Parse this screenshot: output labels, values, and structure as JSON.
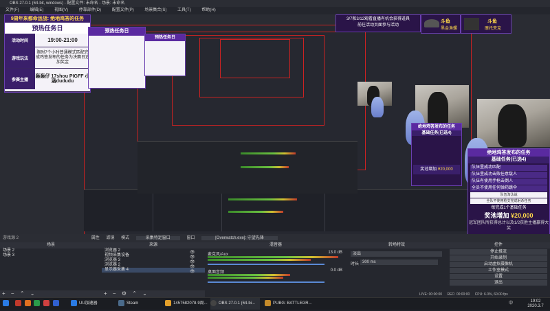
{
  "window": {
    "title": "OBS 27.0.1 (64-bit, windows) - 配置文件: 未命名 - 场景: 未命名"
  },
  "menu": [
    "文件(F)",
    "编辑(E)",
    "视图(V)",
    "停靠部件(D)",
    "配置文件(P)",
    "场景集合(S)",
    "工具(T)",
    "帮助(H)"
  ],
  "overlay": {
    "header": "9周年来都命运战: 绝地鸡答的任务",
    "title": "预热任务日",
    "rows": [
      {
        "key": "活动时间",
        "val": "19:00-21:00"
      },
      {
        "key": "游戏玩法",
        "val": "限时7个小时普通模式匹配完成鸡答发布的任务为决赛日追加奖金"
      },
      {
        "key": "参赛主播",
        "val": "轰轰仔 17shou    PIGFF 小涵dududu"
      }
    ],
    "promo": "3/7和3/12观看直播有机会获得道具\n前往活动页面参与活动",
    "brands": [
      {
        "title": "斗鱼",
        "sub": "黑金渔螺"
      },
      {
        "title": "斗鱼",
        "sub": "摩托夹克"
      }
    ],
    "task_panel": {
      "header": "绝地鸡答发布的任务",
      "sub": "基础任务(已选4)",
      "items": [
        "队伍里成功匹配",
        "队伍里成功击败任意敌人",
        "队伍有使用手枪击倒人",
        "全员不使用任何弹药跳伞"
      ],
      "extra": [
        "队伍淘汰战",
        "全队不使用枪支完成射杀任务"
      ],
      "note": "每完成1个基础任务",
      "bonus_label": "奖池增加",
      "bonus_value": "¥20,000",
      "foot": "冠军团队所获得总计以及1/2获胜主播赢得大奖"
    }
  },
  "toolbar": {
    "items": [
      "属性",
      "滤镜",
      "模式",
      "采集特定窗口",
      "窗口",
      "[Overwatch.exe]: 守望先锋"
    ]
  },
  "scenes": {
    "header": "场景",
    "items": [
      "场景 2",
      "场景 3"
    ]
  },
  "sources": {
    "header": "来源",
    "items": [
      "浏览器 2",
      "视频采集设备",
      "浏览器 3",
      "浏览器 2",
      "显示器采集 4"
    ]
  },
  "mixer": {
    "header": "混音器",
    "tracks": [
      {
        "name": "麦克风/Aux",
        "db": "13.0 dB"
      },
      {
        "name": "桌面音频",
        "db": "0.0 dB"
      }
    ]
  },
  "transition": {
    "header": "转场特效",
    "type": "淡出",
    "duration_label": "时长",
    "duration": "300 ms"
  },
  "controls": {
    "header": "控件",
    "buttons": [
      "停止推流",
      "开始录制",
      "启动虚拟摄像机",
      "工作室模式",
      "设置",
      "退出"
    ]
  },
  "status": {
    "live": "LIVE: 00:00:00",
    "rec": "REC: 00:00:00",
    "cpu": "CPU: 6.0%, 60.00 fps"
  },
  "taskbar": {
    "items": [
      {
        "label": "UU加速器",
        "color": "#2a7be4"
      },
      {
        "label": "Steam",
        "color": "#1b2838"
      },
      {
        "label": "1457582078-9周...",
        "color": "#e4a02a"
      },
      {
        "label": "OBS 27.0.1 (64-bi...",
        "color": "#303030"
      },
      {
        "label": "PUBG: BATTLEGR...",
        "color": "#c48a2a"
      }
    ],
    "time": "19:02",
    "date": "2020.3.7",
    "lang": "中"
  }
}
